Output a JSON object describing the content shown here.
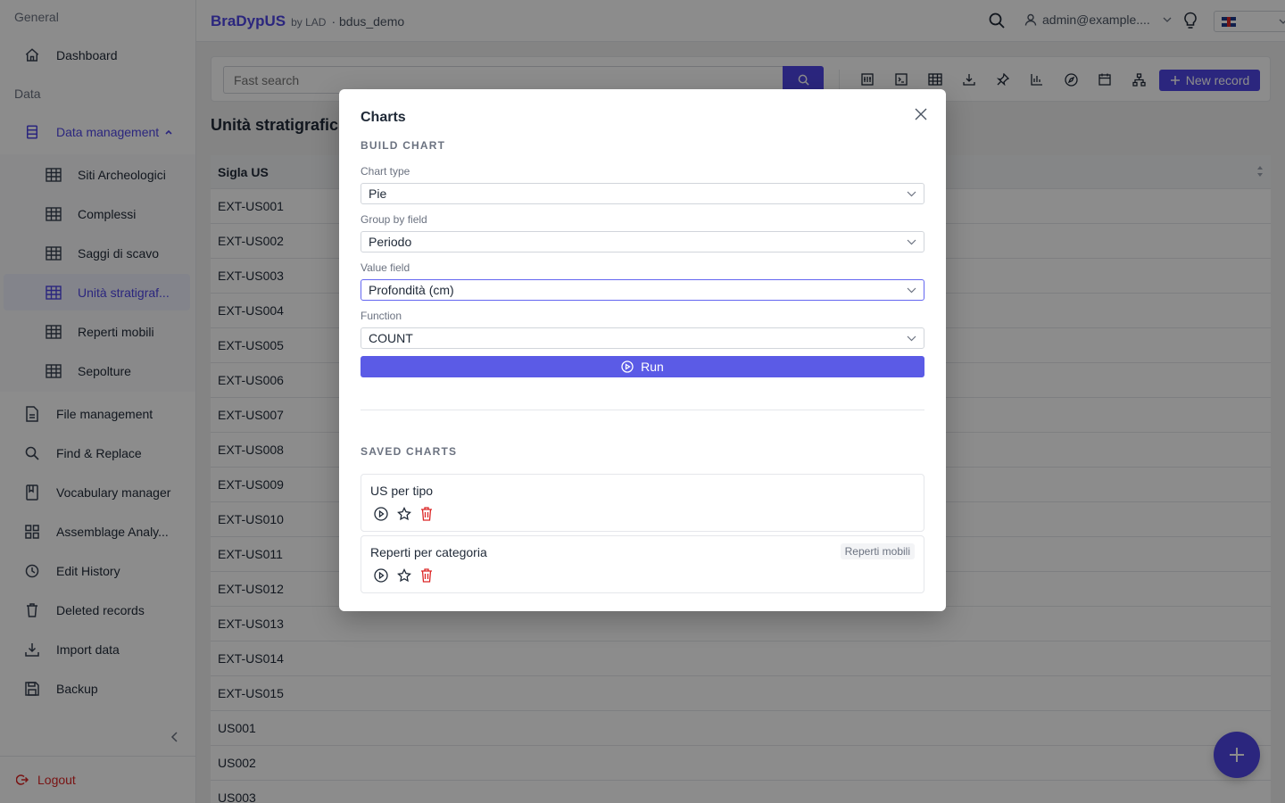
{
  "sidebar": {
    "sections": [
      "General",
      "Data"
    ],
    "items": {
      "dashboard": "Dashboard",
      "data_management": "Data management",
      "sub": [
        "Siti Archeologici",
        "Complessi",
        "Saggi di scavo",
        "Unità stratigraf...",
        "Reperti mobili",
        "Sepolture"
      ],
      "file_management": "File management",
      "find_replace": "Find & Replace",
      "vocabulary": "Vocabulary manager",
      "assemblage": "Assemblage Analy...",
      "edit_history": "Edit History",
      "deleted": "Deleted records",
      "import": "Import data",
      "backup": "Backup"
    },
    "logout": "Logout"
  },
  "header": {
    "brand": "BraDypUS",
    "by": "by LAD",
    "db": "· bdus_demo",
    "user": "admin@example...."
  },
  "toolbar": {
    "search_placeholder": "Fast search",
    "new_record": "New record"
  },
  "main": {
    "title": "Unità stratigrafic",
    "column": "Sigla US",
    "rows": [
      "EXT-US001",
      "EXT-US002",
      "EXT-US003",
      "EXT-US004",
      "EXT-US005",
      "EXT-US006",
      "EXT-US007",
      "EXT-US008",
      "EXT-US009",
      "EXT-US010",
      "EXT-US011",
      "EXT-US012",
      "EXT-US013",
      "EXT-US014",
      "EXT-US015",
      "US001",
      "US002",
      "US003"
    ]
  },
  "modal": {
    "title": "Charts",
    "build_heading": "BUILD CHART",
    "chart_type_label": "Chart type",
    "chart_type_value": "Pie",
    "group_by_label": "Group by field",
    "group_by_value": "Periodo",
    "value_field_label": "Value field",
    "value_field_value": "Profondità (cm)",
    "function_label": "Function",
    "function_value": "COUNT",
    "run_label": "Run",
    "saved_heading": "SAVED CHARTS",
    "saved": [
      {
        "name": "US per tipo",
        "tag": ""
      },
      {
        "name": "Reperti per categoria",
        "tag": "Reperti mobili"
      }
    ]
  },
  "colors": {
    "accent": "#4f46e5",
    "danger": "#dc2626"
  }
}
